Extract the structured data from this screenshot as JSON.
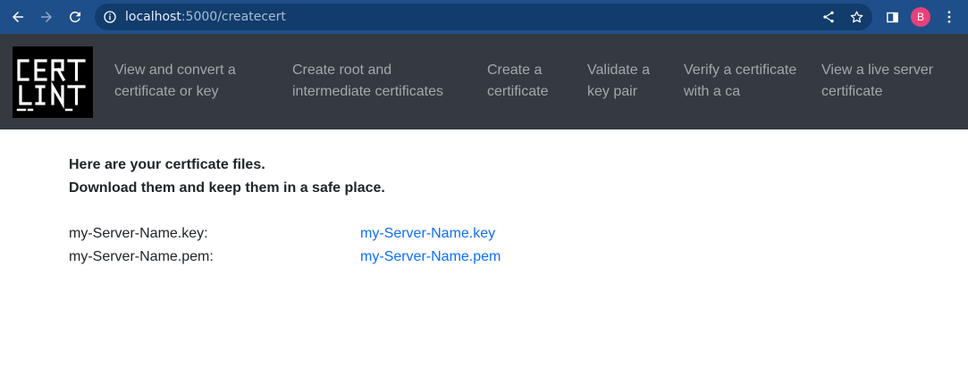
{
  "browser": {
    "url_host": "localhost",
    "url_path": ":5000/createcert",
    "profile_initial": "B"
  },
  "site": {
    "logo_text": "CERT LINT",
    "nav": [
      {
        "line1": "View and convert a",
        "line2": "certificate or key"
      },
      {
        "line1": "Create root and",
        "line2": "intermediate certificates"
      },
      {
        "line1": "Create a",
        "line2": "certificate"
      },
      {
        "line1": "Validate a",
        "line2": "key pair"
      },
      {
        "line1": "Verify a certificate",
        "line2": "with a ca"
      },
      {
        "line1": "View a live server",
        "line2": "certificate"
      }
    ]
  },
  "main": {
    "heading_line1": "Here are your certficate files.",
    "heading_line2": "Download them and keep them in a safe place.",
    "files": [
      {
        "label": "my-Server-Name.key:",
        "link": "my-Server-Name.key"
      },
      {
        "label": "my-Server-Name.pem:",
        "link": "my-Server-Name.pem"
      }
    ]
  },
  "colors": {
    "chrome": "#1f4f8a",
    "navbar": "#343a40",
    "link": "#0d6efd",
    "avatar": "#e8417a"
  }
}
